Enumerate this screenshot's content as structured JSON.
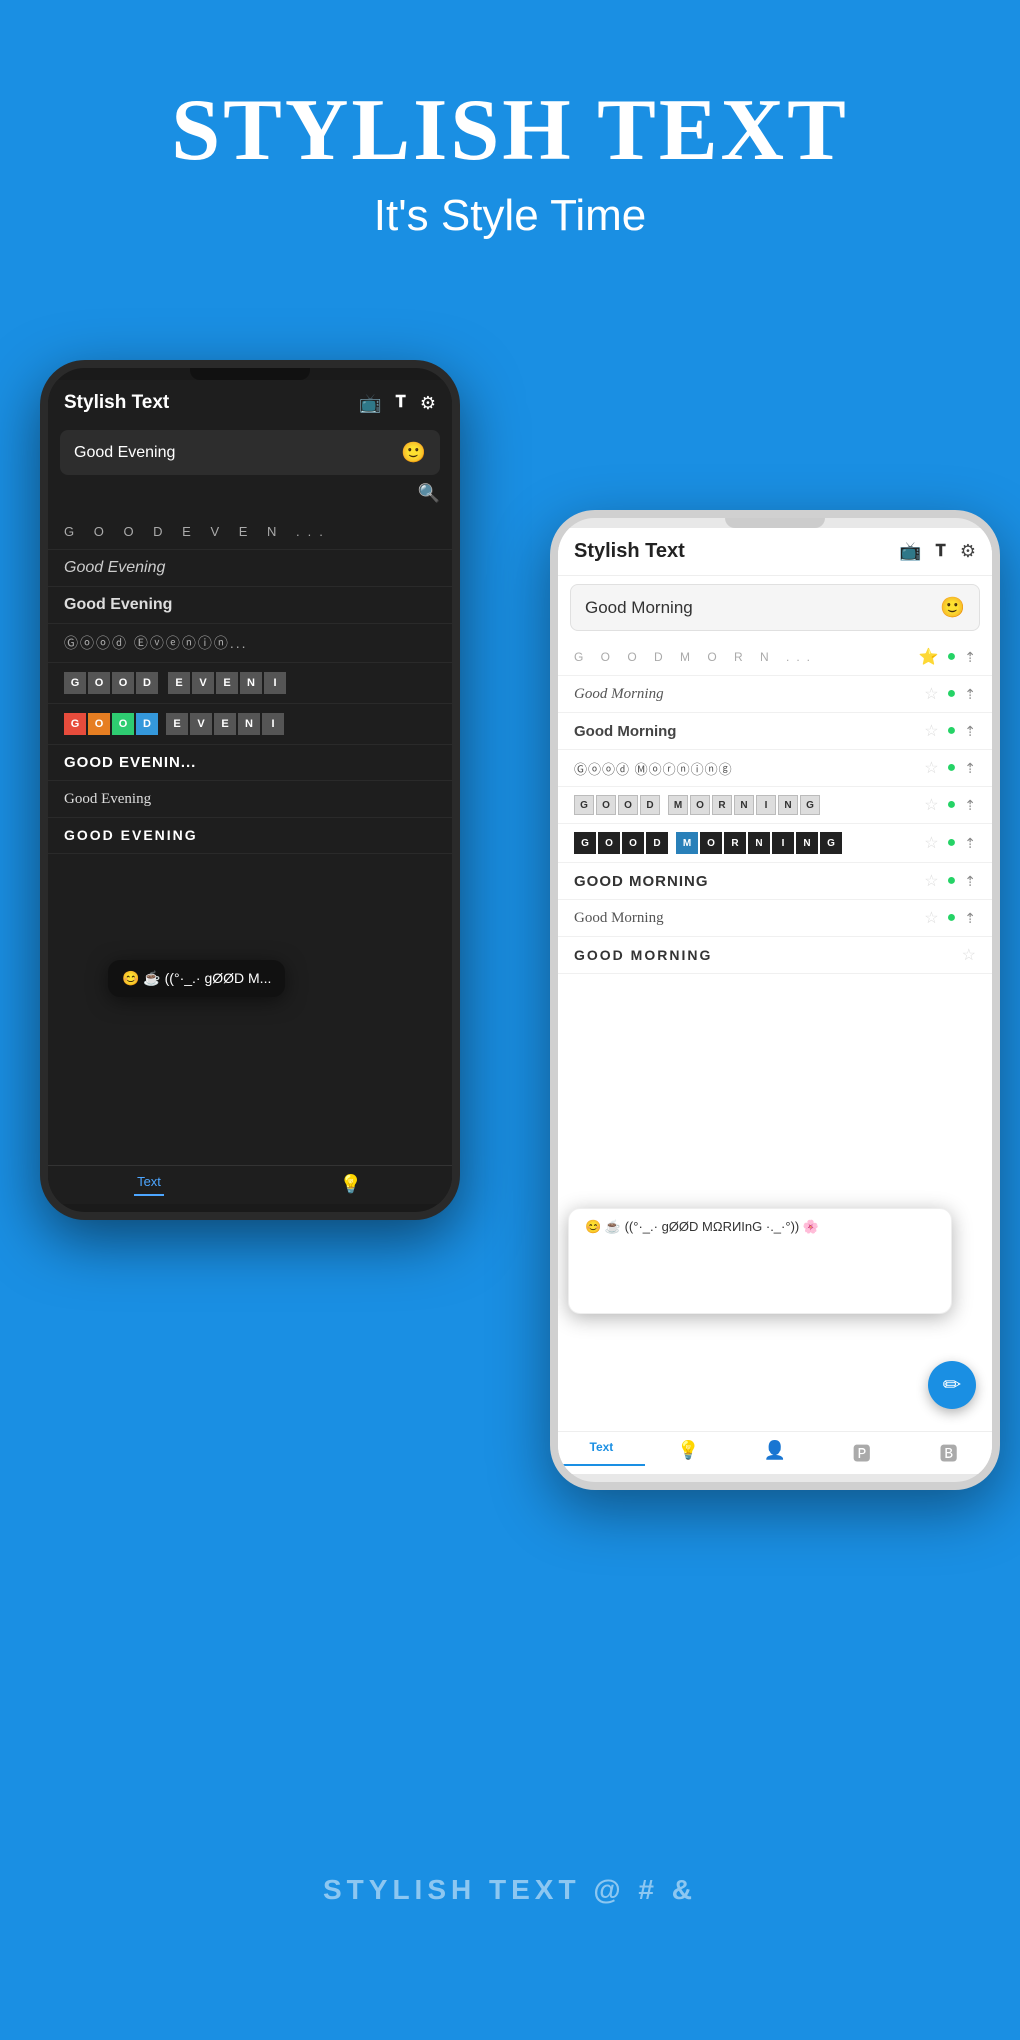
{
  "header": {
    "main_title": "Stylish Text",
    "subtitle": "It's Style Time"
  },
  "dark_phone": {
    "app_title": "Stylish Text",
    "input_value": "Good Evening",
    "icons": [
      "📺",
      "𝐓",
      "⚙"
    ],
    "text_styles": [
      {
        "style": "spaced",
        "text": "G O O D  E V E N..."
      },
      {
        "style": "script",
        "text": "Good Evening"
      },
      {
        "style": "bold-serif",
        "text": "Good Evening"
      },
      {
        "style": "circle",
        "text": "Ⓖⓞⓞⓓ Ⓔⓥⓔⓝⓘⓝ..."
      },
      {
        "style": "box",
        "text": "GOOD EVENIN..."
      },
      {
        "style": "colored-box",
        "text": "G O O D E V E N I"
      },
      {
        "style": "large",
        "text": "GOOD EVENIN..."
      },
      {
        "style": "gothic",
        "text": "Good Evening"
      },
      {
        "style": "caps",
        "text": "GOOD EVENING"
      }
    ],
    "emoji_popup": "😊 ☕ ((°·_.· gØØD M...",
    "bottom_nav": [
      {
        "label": "Text",
        "active": true
      },
      {
        "label": "🔍",
        "active": false
      }
    ]
  },
  "light_phone": {
    "app_title": "Stylish Text",
    "input_value": "Good Morning",
    "input_cursor": true,
    "icons": [
      "📺",
      "𝐓",
      "⚙"
    ],
    "text_styles": [
      {
        "style": "spaced",
        "text": "G O O D  M O R N..."
      },
      {
        "style": "script",
        "text": "Good Morning"
      },
      {
        "style": "bold-serif",
        "text": "Good Morning"
      },
      {
        "style": "circle",
        "text": "Ⓖⓞⓞⓓ Ⓜⓞⓡⓝⓘⓝⓖ"
      },
      {
        "style": "box",
        "text": "GOOD MORNING"
      },
      {
        "style": "colored-box",
        "text": "GOOD MORNING"
      },
      {
        "style": "large",
        "text": "GOOD MORNING"
      },
      {
        "style": "gothic",
        "text": "Good Morning"
      },
      {
        "style": "caps",
        "text": "GOOD MORNING"
      }
    ],
    "emoji_popup": "😊 ☕ ((°·_.· gØØD MΩRИInG ·._·°)) 🌸",
    "fab_label": "✏",
    "bottom_nav": [
      {
        "label": "Text",
        "active": true
      },
      {
        "label": "💡",
        "active": false
      },
      {
        "label": "👤",
        "active": false
      },
      {
        "label": "🅿",
        "active": false
      },
      {
        "label": "🅱",
        "active": false
      }
    ]
  },
  "bottom_badge_text": "Stylish Text @ # &"
}
